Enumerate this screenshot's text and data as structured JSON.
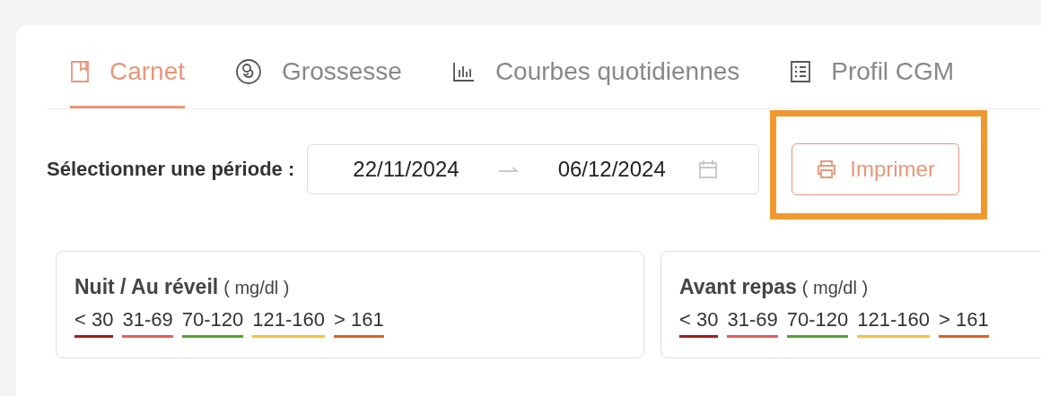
{
  "tabs": [
    {
      "label": "Carnet",
      "kind": "book",
      "selected": true
    },
    {
      "label": "Grossesse",
      "kind": "fetus",
      "selected": false
    },
    {
      "label": "Courbes quotidiennes",
      "kind": "chart",
      "selected": false
    },
    {
      "label": "Profil CGM",
      "kind": "list",
      "selected": false
    }
  ],
  "period": {
    "label": "Sélectionner une période :",
    "start": "22/11/2024",
    "end": "06/12/2024"
  },
  "print_button": {
    "label": "Imprimer",
    "highlighted": true
  },
  "legends": [
    {
      "title": "Nuit / Au réveil",
      "unit": "( mg/dl )",
      "ranges": [
        {
          "label": "< 30",
          "color": "#a01c1c"
        },
        {
          "label": "31-69",
          "color": "#e95c5c"
        },
        {
          "label": "70-120",
          "color": "#55a030"
        },
        {
          "label": "121-160",
          "color": "#f5c242"
        },
        {
          "label": "> 161",
          "color": "#e0601c"
        }
      ]
    },
    {
      "title": "Avant repas",
      "unit": "( mg/dl )",
      "ranges": [
        {
          "label": "< 30",
          "color": "#a01c1c"
        },
        {
          "label": "31-69",
          "color": "#e95c5c"
        },
        {
          "label": "70-120",
          "color": "#55a030"
        },
        {
          "label": "121-160",
          "color": "#f5c242"
        },
        {
          "label": "> 161",
          "color": "#e0601c"
        }
      ]
    }
  ]
}
